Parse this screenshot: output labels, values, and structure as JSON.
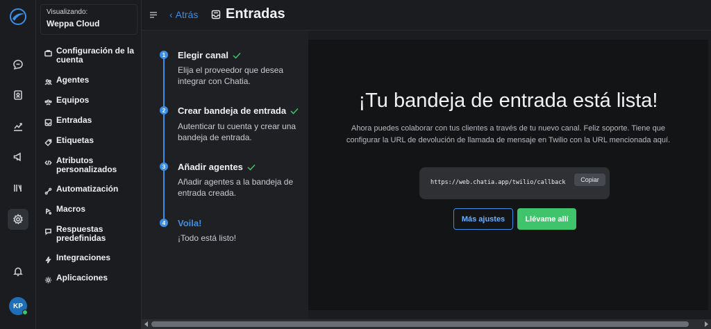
{
  "app": {
    "account_caption": "Visualizando:",
    "account_name": "Weppa Cloud",
    "avatar_initials": "KP"
  },
  "rail": {
    "icons": [
      "logo-icon",
      "chat-icon",
      "contacts-icon",
      "reports-icon",
      "campaigns-icon",
      "library-icon",
      "settings-icon",
      "bell-icon"
    ]
  },
  "sidebar": {
    "items": [
      {
        "label": "Configuración de la cuenta",
        "icon": "briefcase-icon"
      },
      {
        "label": "Agentes",
        "icon": "people-icon"
      },
      {
        "label": "Equipos",
        "icon": "team-icon"
      },
      {
        "label": "Entradas",
        "icon": "inbox-icon"
      },
      {
        "label": "Etiquetas",
        "icon": "tag-icon"
      },
      {
        "label": "Atributos personalizados",
        "icon": "code-icon"
      },
      {
        "label": "Automatización",
        "icon": "automation-icon"
      },
      {
        "label": "Macros",
        "icon": "macros-icon"
      },
      {
        "label": "Respuestas predefinidas",
        "icon": "chat-bubble-icon"
      },
      {
        "label": "Integraciones",
        "icon": "flash-icon"
      },
      {
        "label": "Aplicaciones",
        "icon": "apps-icon"
      }
    ]
  },
  "header": {
    "back_label": "Atrás",
    "title": "Entradas"
  },
  "steps": [
    {
      "number": "1",
      "title": "Elegir canal",
      "desc": "Elija el proveedor que desea integrar con Chatia.",
      "done": true
    },
    {
      "number": "2",
      "title": "Crear bandeja de entrada",
      "desc": "Autenticar tu cuenta y crear una bandeja de entrada.",
      "done": true
    },
    {
      "number": "3",
      "title": "Añadir agentes",
      "desc": "Añadir agentes a la bandeja de entrada creada.",
      "done": true
    },
    {
      "number": "4",
      "title": "Voila!",
      "desc": "¡Todo está listo!",
      "done": false
    }
  ],
  "main": {
    "title": "¡Tu bandeja de entrada está lista!",
    "description": "Ahora puedes colaborar con tus clientes a través de tu nuevo canal. Feliz soporte. Tiene que configurar la URL de devolución de llamada de mensaje en Twilio con la URL mencionada aquí.",
    "callback_url": "https://web.chatia.app/twilio/callback",
    "copy_label": "Copiar",
    "more_settings_label": "Más ajustes",
    "take_me_label": "Llévame allí"
  },
  "colors": {
    "accent": "#3b8fe6",
    "success": "#3fc46b",
    "background": "#1b1c1f",
    "panel": "#131416"
  }
}
